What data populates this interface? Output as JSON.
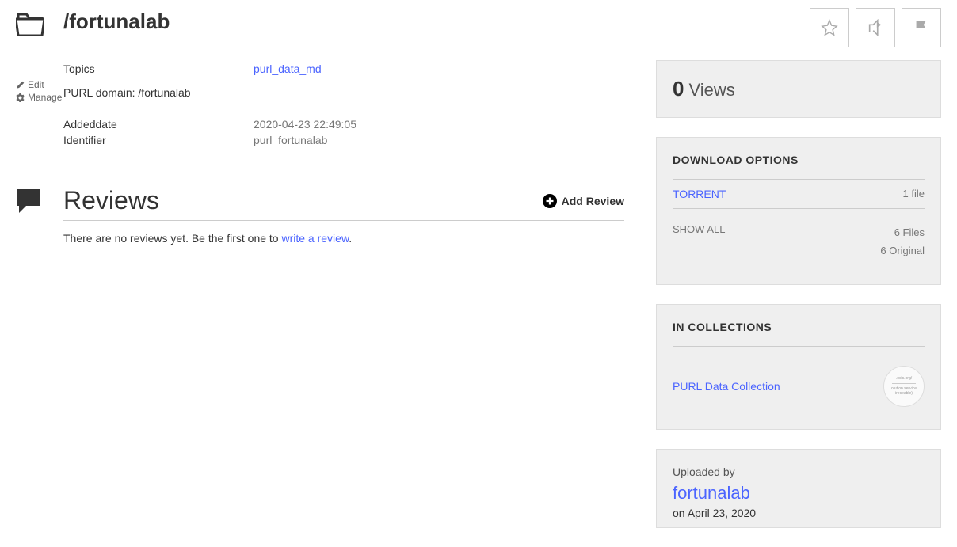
{
  "title": "/fortunalab",
  "left_actions": {
    "edit": "Edit",
    "manage": "Manage"
  },
  "meta": {
    "topics_label": "Topics",
    "topics_value": "purl_data_md",
    "purl_domain": "PURL domain: /fortunalab",
    "addeddate_label": "Addeddate",
    "addeddate_value": "2020-04-23 22:49:05",
    "identifier_label": "Identifier",
    "identifier_value": "purl_fortunalab"
  },
  "reviews": {
    "heading": "Reviews",
    "add_label": "Add Review",
    "empty_prefix": "There are no reviews yet. Be the first one to ",
    "write_link": "write a review",
    "period": "."
  },
  "views": {
    "count": "0",
    "label": "Views"
  },
  "downloads": {
    "heading": "DOWNLOAD OPTIONS",
    "torrent_label": "TORRENT",
    "torrent_meta": "1 file",
    "show_all": "SHOW ALL",
    "files_count": "6 Files",
    "original_count": "6 Original"
  },
  "collections": {
    "heading": "IN COLLECTIONS",
    "item": "PURL Data Collection"
  },
  "uploaded": {
    "label": "Uploaded by",
    "user": "fortunalab",
    "date": "on April 23, 2020"
  }
}
